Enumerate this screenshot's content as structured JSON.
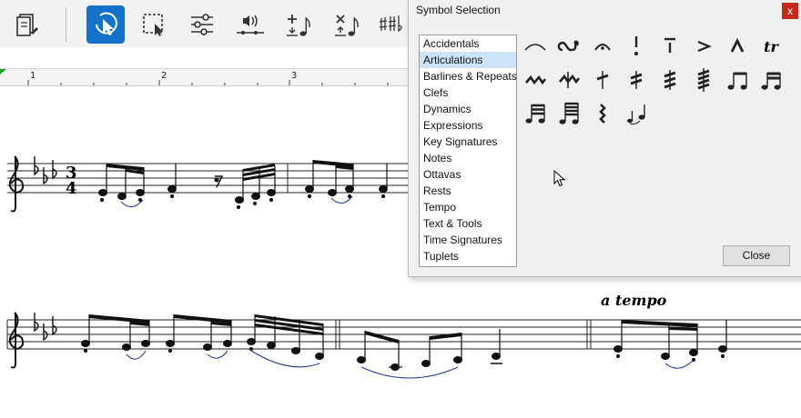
{
  "toolbar": {
    "buttons": [
      {
        "name": "score-setup-icon",
        "active": false
      },
      {
        "name": "select-arrow-icon",
        "active": true
      },
      {
        "name": "rectangle-select-icon",
        "active": false
      },
      {
        "name": "mixer-sliders-icon",
        "active": false
      },
      {
        "name": "speaker-playback-icon",
        "active": false
      },
      {
        "name": "add-note-icon",
        "active": false
      },
      {
        "name": "delete-note-icon",
        "active": false
      },
      {
        "name": "accidentals-icon",
        "active": false
      }
    ]
  },
  "ruler": {
    "marks": [
      "1",
      "2",
      "3"
    ]
  },
  "score": {
    "tempo_text": "a tempo",
    "time_sig_top": "3",
    "time_sig_bottom": "4"
  },
  "dialog": {
    "title": "Symbol Selection",
    "close_x": "x",
    "categories": [
      "Accidentals",
      "Articulations",
      "Barlines & Repeats",
      "Clefs",
      "Dynamics",
      "Expressions",
      "Key Signatures",
      "Notes",
      "Ottavas",
      "Rests",
      "Tempo",
      "Text & Tools",
      "Time Signatures",
      "Tuplets"
    ],
    "selected_category": "Articulations",
    "symbols": [
      {
        "name": "slur-symbol-icon"
      },
      {
        "name": "turn-symbol-icon"
      },
      {
        "name": "fermata-symbol-icon"
      },
      {
        "name": "staccato-symbol-icon"
      },
      {
        "name": "tenuto-symbol-icon"
      },
      {
        "name": "accent-symbol-icon"
      },
      {
        "name": "marcato-symbol-icon"
      },
      {
        "name": "trill-symbol-icon",
        "text": "tr"
      },
      {
        "name": "mordent-symbol-icon"
      },
      {
        "name": "inverted-mordent-symbol-icon"
      },
      {
        "name": "tremolo-1-symbol-icon"
      },
      {
        "name": "tremolo-2-symbol-icon"
      },
      {
        "name": "tremolo-3-symbol-icon"
      },
      {
        "name": "tremolo-4-symbol-icon"
      },
      {
        "name": "beamed-eighths-symbol-icon"
      },
      {
        "name": "beamed-sixteenths-symbol-icon"
      },
      {
        "name": "beamed-32nds-symbol-icon"
      },
      {
        "name": "beamed-64ths-symbol-icon"
      },
      {
        "name": "zigzag-tremolo-symbol-icon"
      },
      {
        "name": "grace-note-slur-symbol-icon"
      }
    ],
    "close_label": "Close"
  },
  "colors": {
    "accent": "#1473c9",
    "selected_bg": "#cce4f7",
    "close_red": "#c42b1c",
    "slur": "#2b3a8c"
  }
}
